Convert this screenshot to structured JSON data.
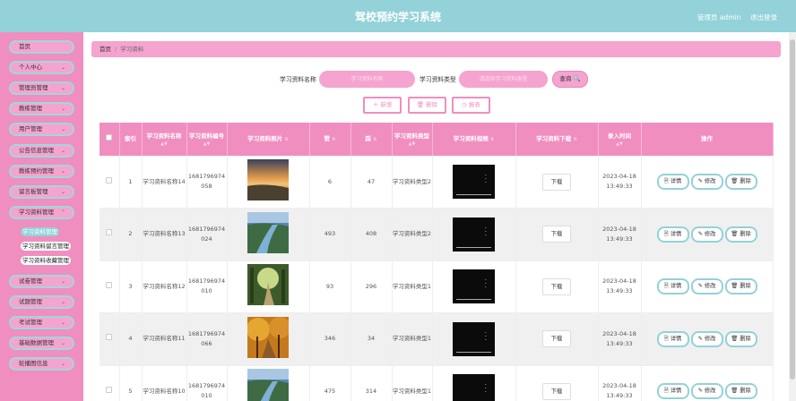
{
  "header": {
    "title": "驾校预约学习系统",
    "admin": "管理员 admin",
    "logout": "退出登录"
  },
  "sidebar": {
    "items": [
      {
        "label": "首页",
        "chev": ""
      },
      {
        "label": "个人中心",
        "chev": "⌄"
      },
      {
        "label": "管理员管理",
        "chev": "⌄"
      },
      {
        "label": "教练管理",
        "chev": "⌄"
      },
      {
        "label": "用户管理",
        "chev": "⌄"
      },
      {
        "label": "公告信息管理",
        "chev": "⌄"
      },
      {
        "label": "教练预约管理",
        "chev": "⌄"
      },
      {
        "label": "留言板管理",
        "chev": "⌄"
      },
      {
        "label": "学习资料管理",
        "chev": "⌃"
      },
      {
        "label": "试卷管理",
        "chev": "⌄"
      },
      {
        "label": "试题管理",
        "chev": "⌄"
      },
      {
        "label": "考试管理",
        "chev": "⌄"
      },
      {
        "label": "基础数据管理",
        "chev": "⌄"
      },
      {
        "label": "轮播图信息",
        "chev": "⌄"
      }
    ],
    "subitems": [
      "学习资料管理",
      "学习资料留言管理",
      "学习资料收藏管理"
    ]
  },
  "breadcrumb": {
    "home": "首页",
    "sep": "/",
    "current": "学习资料"
  },
  "search": {
    "name_label": "学习资料名称",
    "name_placeholder": "学习资料名称",
    "type_label": "学习资料类型",
    "type_placeholder": "请选择学习资料类型",
    "query_label": "查询 🔍"
  },
  "actions": {
    "add": "＋ 新增",
    "delete": "🗑 删除",
    "report": "◷ 报表"
  },
  "table": {
    "headers": [
      "",
      "索引",
      "学习资料名称",
      "学习资料编号",
      "学习资料照片",
      "赞",
      "踩",
      "学习资料类型",
      "学习资料视频",
      "学习资料下载",
      "录入时间",
      "操作"
    ],
    "download_label": "下载",
    "detail_label": "🗎 详情",
    "edit_label": "✎ 修改",
    "del_label": "🗑 删除",
    "rows": [
      {
        "index": "1",
        "name": "学习资料名称14",
        "number": "1681796974058",
        "likes": "6",
        "dislikes": "47",
        "type": "学习资料类型2",
        "time": "2023-04-18 13:49:33",
        "img": "beach"
      },
      {
        "index": "2",
        "name": "学习资料名称13",
        "number": "1681796974024",
        "likes": "493",
        "dislikes": "408",
        "type": "学习资料类型2",
        "time": "2023-04-18 13:49:33",
        "img": "river"
      },
      {
        "index": "3",
        "name": "学习资料名称12",
        "number": "1681796974010",
        "likes": "93",
        "dislikes": "296",
        "type": "学习资料类型1",
        "time": "2023-04-18 13:49:33",
        "img": "forest"
      },
      {
        "index": "4",
        "name": "学习资料名称11",
        "number": "1681796974066",
        "likes": "346",
        "dislikes": "34",
        "type": "学习资料类型1",
        "time": "2023-04-18 13:49:33",
        "img": "autumn"
      },
      {
        "index": "5",
        "name": "学习资料名称10",
        "number": "1681796974010",
        "likes": "475",
        "dislikes": "314",
        "type": "学习资料类型1",
        "time": "2023-04-18 13:49:33",
        "img": "river"
      }
    ]
  },
  "colors": {
    "header": "#93d2d8",
    "sidebar": "#f08ec0",
    "accent_pink": "#f5a3cf",
    "accent_teal": "#93d2d8"
  }
}
